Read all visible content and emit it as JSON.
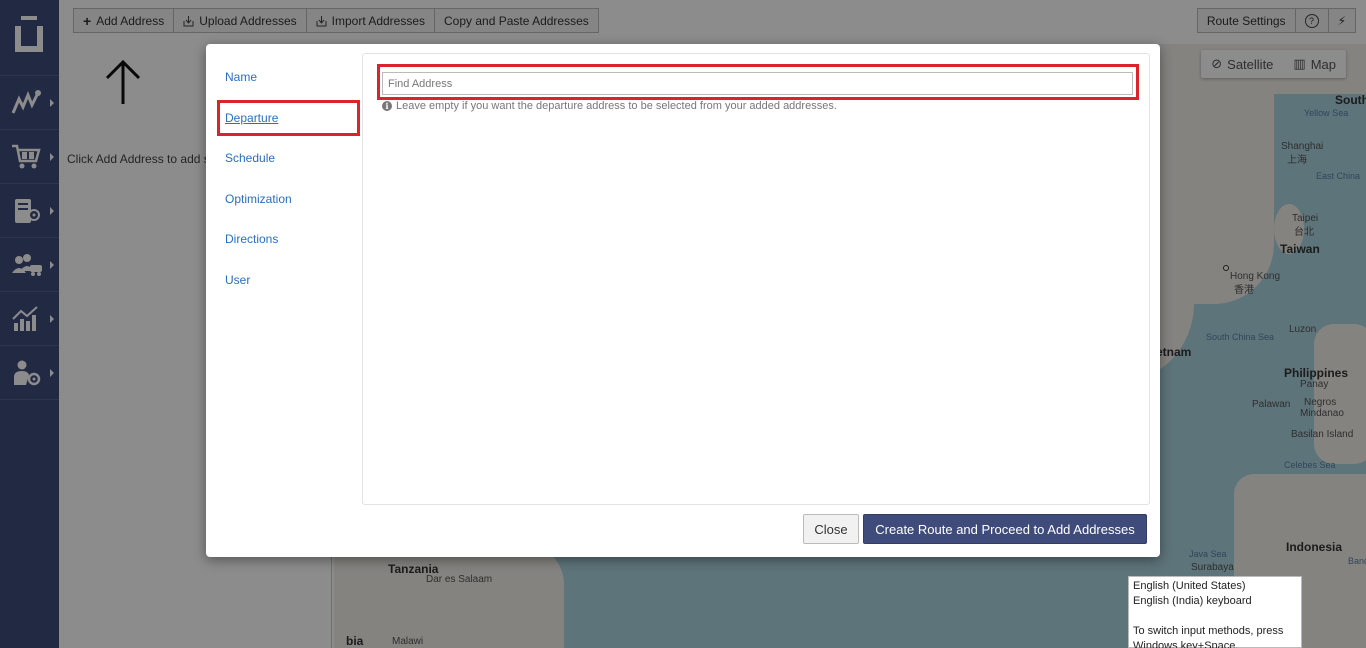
{
  "toolbar": {
    "buttons": [
      {
        "label": "Add Address",
        "icon": "plus-icon"
      },
      {
        "label": "Upload Addresses",
        "icon": "upload-icon"
      },
      {
        "label": "Import Addresses",
        "icon": "import-icon"
      },
      {
        "label": "Copy and Paste Addresses",
        "icon": ""
      }
    ],
    "route_settings_label": "Route Settings",
    "help_icon": "help-icon",
    "lightning_icon": "lightning-icon"
  },
  "left_panel": {
    "hint": "Click Add Address to add stops"
  },
  "map": {
    "controls": {
      "satellite": "Satellite",
      "map": "Map"
    },
    "labels": {
      "south": "South",
      "yellow_sea": "Yellow Sea",
      "shanghai": "Shanghai",
      "shanghai_cn": "上海",
      "east_china": "East China",
      "taipei": "Taipei",
      "taipei_cn": "台北",
      "taiwan": "Taiwan",
      "hong_kong": "Hong Kong",
      "hong_kong_cn": "香港",
      "south_china_sea": "South China Sea",
      "luzon": "Luzon",
      "vietnam": "etnam",
      "philippines": "Philippines",
      "panay": "Panay",
      "negros": "Negros",
      "palawan": "Palawan",
      "mindanao": "Mindanao",
      "basilan": "Basilan Island",
      "celebes_sea": "Celebes Sea",
      "indonesia": "Indonesia",
      "java_sea": "Java Sea",
      "surabaya": "Surabaya",
      "banda": "Banda",
      "tanzania": "Tanzania",
      "dar_es_salaam": "Dar es Salaam",
      "malawi": "Malawi",
      "bia": "bia"
    }
  },
  "modal": {
    "nav": {
      "name": "Name",
      "departure": "Departure",
      "schedule": "Schedule",
      "optimization": "Optimization",
      "directions": "Directions",
      "user": "User"
    },
    "find_address_placeholder": "Find Address",
    "find_address_value": "",
    "helper_text": "Leave empty if you want the departure address to be selected from your added addresses.",
    "close_label": "Close",
    "primary_label": "Create Route and Proceed to Add Addresses"
  },
  "ime_tooltip": {
    "line1": "English (United States)",
    "line2": "English (India) keyboard",
    "line3": "To switch input methods, press",
    "line4": "Windows key+Space."
  },
  "colors": {
    "sidebar": "#3f4b7a",
    "primary_button": "#3f4b7a",
    "highlight": "#d9232d",
    "link": "#2a6ebd"
  }
}
